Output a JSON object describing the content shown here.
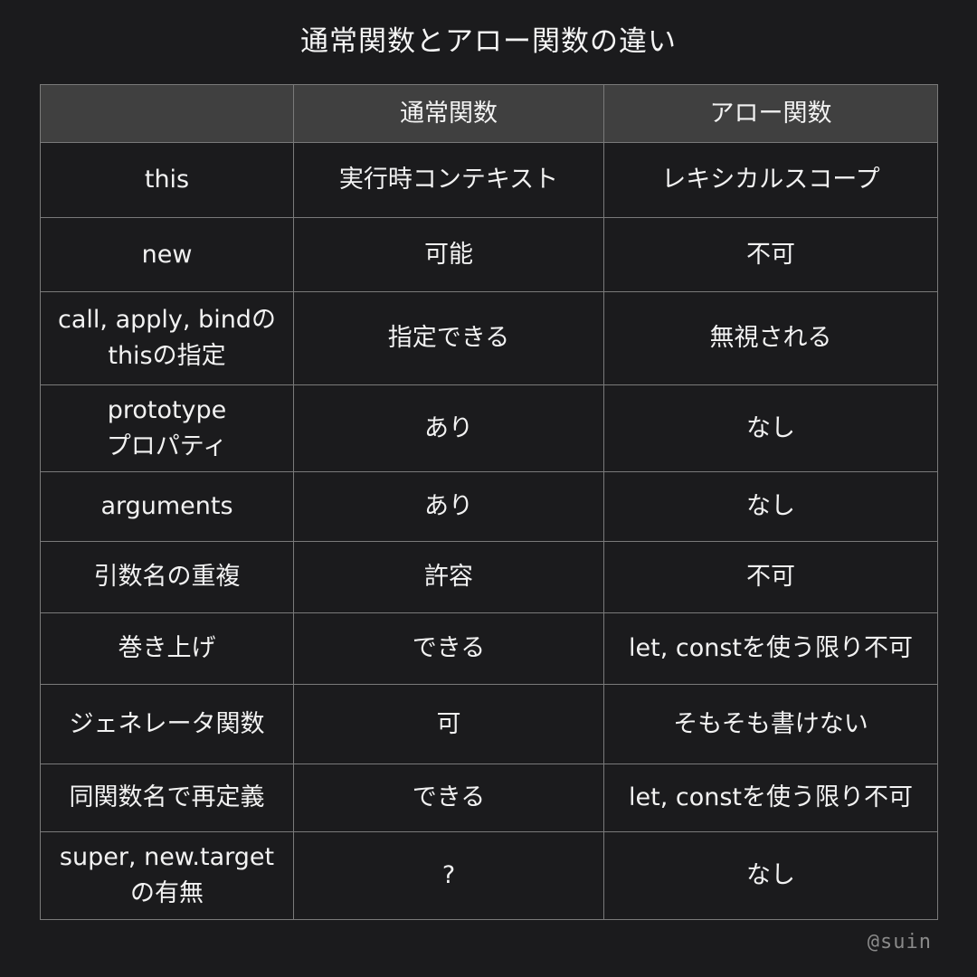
{
  "title": "通常関数とアロー関数の違い",
  "table": {
    "headers": [
      "",
      "通常関数",
      "アロー関数"
    ],
    "rows": [
      {
        "feature": "this",
        "normal": "実行時コンテキスト",
        "arrow": "レキシカルスコープ"
      },
      {
        "feature": "new",
        "normal": "可能",
        "arrow": "不可"
      },
      {
        "feature": "call, apply, bindの\nthisの指定",
        "normal": "指定できる",
        "arrow": "無視される"
      },
      {
        "feature": "prototype\nプロパティ",
        "normal": "あり",
        "arrow": "なし"
      },
      {
        "feature": "arguments",
        "normal": "あり",
        "arrow": "なし"
      },
      {
        "feature": "引数名の重複",
        "normal": "許容",
        "arrow": "不可"
      },
      {
        "feature": "巻き上げ",
        "normal": "できる",
        "arrow": "let, constを使う限り不可"
      },
      {
        "feature": "ジェネレータ関数",
        "normal": "可",
        "arrow": "そもそも書けない"
      },
      {
        "feature": "同関数名で再定義",
        "normal": "できる",
        "arrow": "let, constを使う限り不可"
      },
      {
        "feature": "super, new.target\nの有無",
        "normal": "?",
        "arrow": "なし"
      }
    ]
  },
  "credit": "@suin"
}
